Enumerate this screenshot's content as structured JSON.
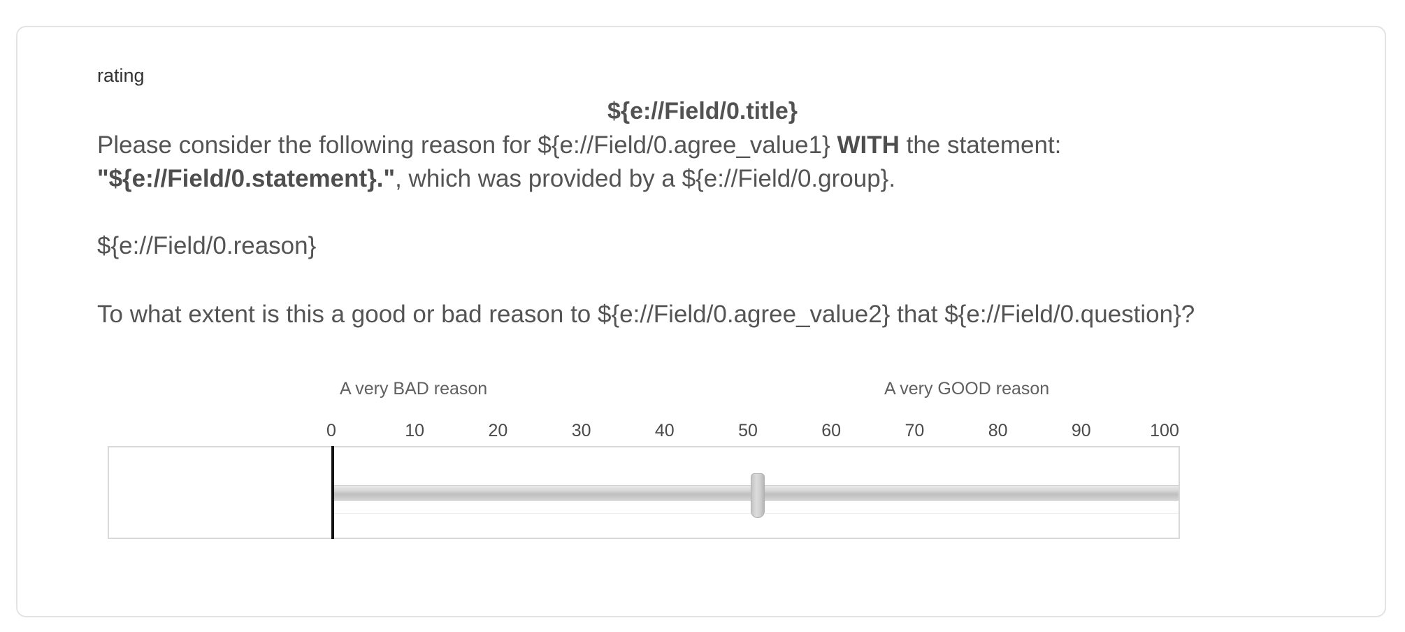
{
  "question": {
    "label": "rating",
    "title": "${e://Field/0.title}",
    "line1": {
      "pre": "Please consider the following reason for ${e://Field/0.agree_value1} ",
      "bold": "WITH",
      "post": " the statement:"
    },
    "line2": {
      "bold": "\"${e://Field/0.statement}.\"",
      "post": ", which was provided by a ${e://Field/0.group}."
    },
    "reason": "${e://Field/0.reason}",
    "prompt": "To what extent is this a good or bad reason to ${e://Field/0.agree_value2} that ${e://Field/0.question}?"
  },
  "slider": {
    "anchor_left": "A very BAD reason",
    "anchor_right": "A very GOOD reason",
    "row_label": "",
    "min": 0,
    "max": 100,
    "ticks": [
      "0",
      "10",
      "20",
      "30",
      "40",
      "50",
      "60",
      "70",
      "80",
      "90",
      "100"
    ],
    "value": 50
  }
}
